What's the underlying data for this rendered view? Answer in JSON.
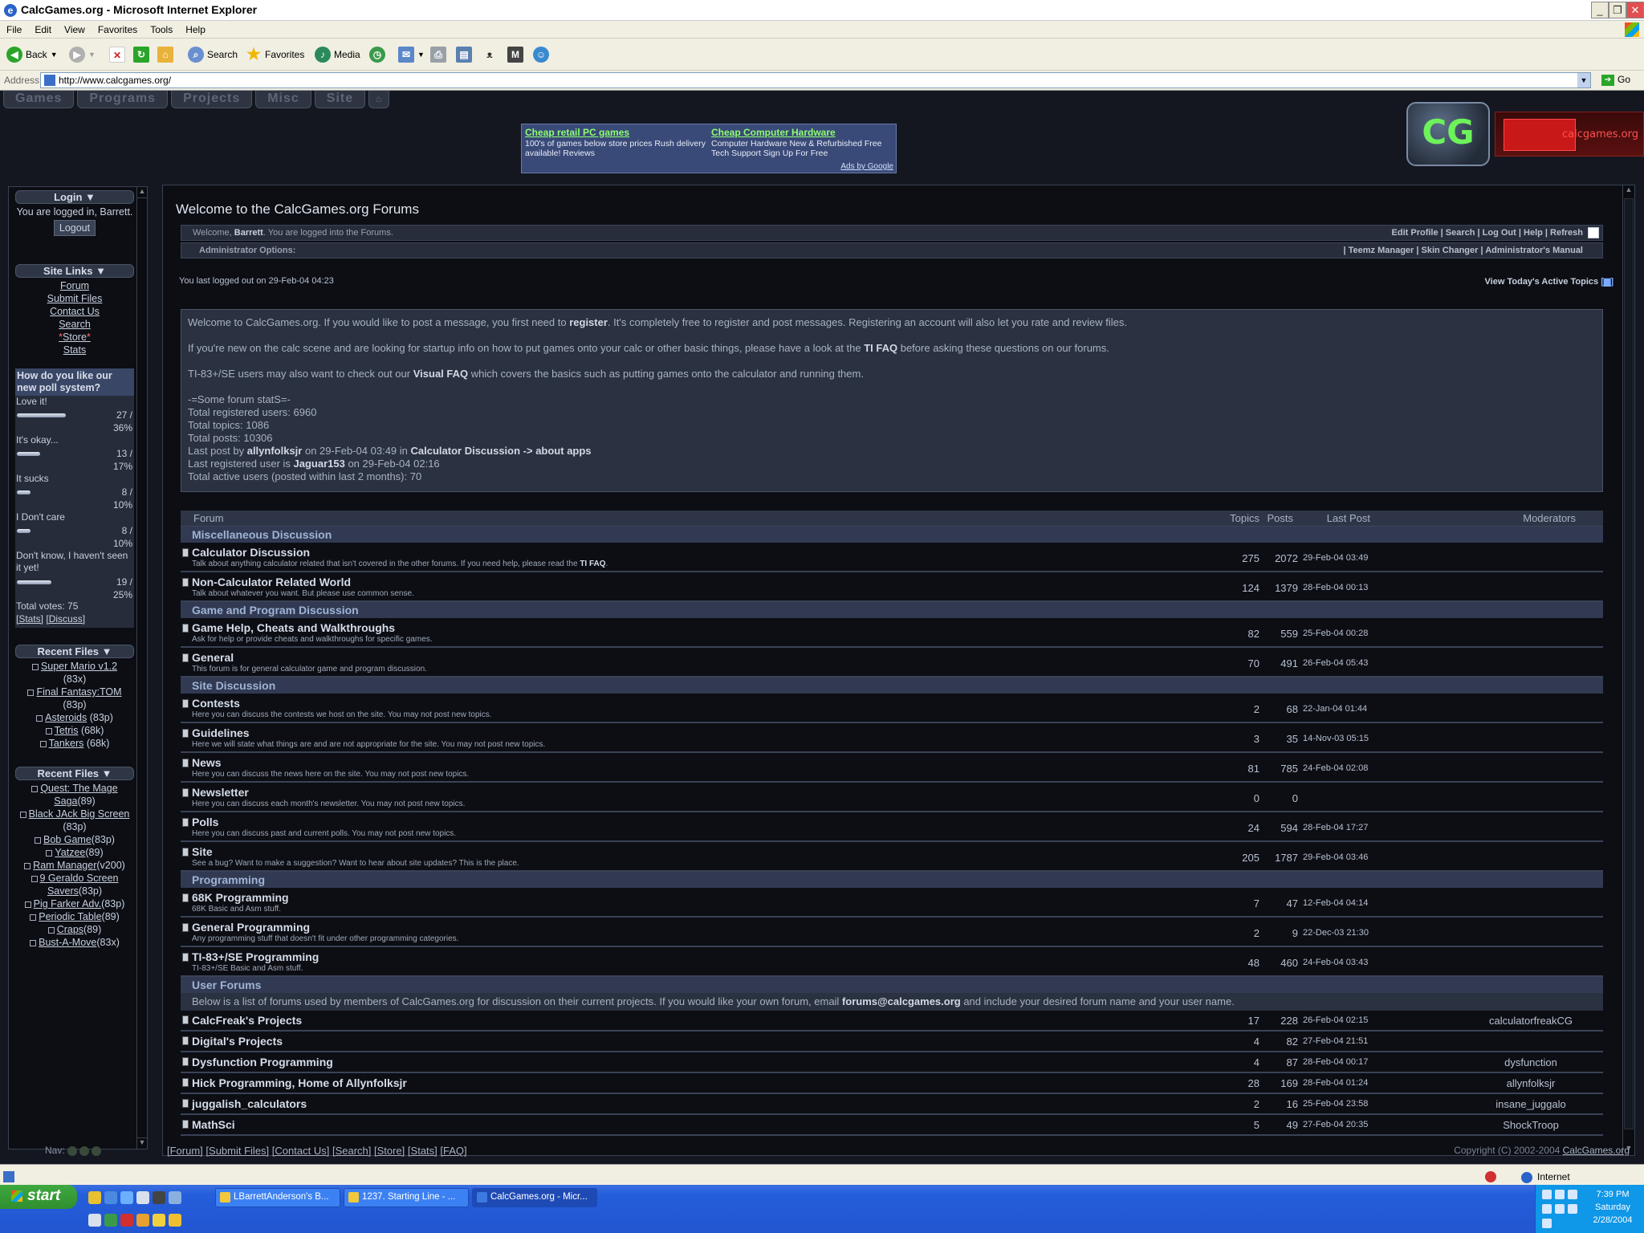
{
  "window": {
    "title": "CalcGames.org - Microsoft Internet Explorer"
  },
  "menu": [
    "File",
    "Edit",
    "View",
    "Favorites",
    "Tools",
    "Help"
  ],
  "toolbar": {
    "back": "Back",
    "search": "Search",
    "favorites": "Favorites",
    "media": "Media"
  },
  "address": {
    "label": "Address",
    "url": "http://www.calcgames.org/",
    "go": "Go"
  },
  "site_tabs": [
    "Games",
    "Programs",
    "Projects",
    "Misc",
    "Site"
  ],
  "ad": {
    "items": [
      {
        "title": "Cheap retail PC games",
        "text": "100's of games below store prices Rush delivery available! Reviews"
      },
      {
        "title": "Cheap Computer Hardware",
        "text": "Computer Hardware New & Refurbished Free Tech Support Sign Up For Free"
      }
    ],
    "by": "Ads by Google"
  },
  "logo": {
    "mark": "CG",
    "text": "calcgames.org"
  },
  "sidebar": {
    "login_head": "Login ▼",
    "login_text": "You are logged in, Barrett.",
    "logout": "Logout",
    "links_head": "Site Links ▼",
    "links": [
      "Forum",
      "Submit Files",
      "Contact Us",
      "Search",
      "Store",
      "Stats"
    ],
    "store_star": "*",
    "poll": {
      "question": "How do you like our new poll system?",
      "options": [
        {
          "label": "Love it!",
          "count": "27 /",
          "pct": "36%",
          "frac": 0.36
        },
        {
          "label": "It's okay...",
          "count": "13 /",
          "pct": "17%",
          "frac": 0.17
        },
        {
          "label": "It sucks",
          "count": "8 /",
          "pct": "10%",
          "frac": 0.1
        },
        {
          "label": "I Don't care",
          "count": "8 /",
          "pct": "10%",
          "frac": 0.1
        },
        {
          "label": "Don't know, I haven't seen it yet!",
          "count": "19 /",
          "pct": "25%",
          "frac": 0.25
        }
      ],
      "total": "Total votes: 75",
      "stats": "[Stats]",
      "discuss": "[Discuss]"
    },
    "recent1_head": "Recent Files ▼",
    "recent1": [
      {
        "name": "Super Mario v1.2",
        "tag": "(83x)"
      },
      {
        "name": "Final Fantasy:TOM",
        "tag": "(83p)"
      },
      {
        "name": "Asteroids",
        "tag": "(83p)"
      },
      {
        "name": "Tetris",
        "tag": "(68k)"
      },
      {
        "name": "Tankers",
        "tag": "(68k)"
      }
    ],
    "recent2_head": "Recent Files ▼",
    "recent2": [
      {
        "name": "Quest: The Mage Saga",
        "tag": "(89)"
      },
      {
        "name": "Black JAck Big Screen",
        "tag": "(83p)"
      },
      {
        "name": "Bob Game",
        "tag": "(83p)"
      },
      {
        "name": "Yatzee",
        "tag": "(89)"
      },
      {
        "name": "Ram Manager",
        "tag": "(v200)"
      },
      {
        "name": "9 Geraldo Screen Savers",
        "tag": "(83p)"
      },
      {
        "name": "Pig Farker Adv.",
        "tag": "(83p)"
      },
      {
        "name": "Periodic Table",
        "tag": "(89)"
      },
      {
        "name": "Craps",
        "tag": "(89)"
      },
      {
        "name": "Bust-A-Move",
        "tag": "(83x)"
      }
    ]
  },
  "main": {
    "title": "Welcome to the CalcGames.org Forums",
    "welcome_pre": "Welcome, ",
    "user": "Barrett",
    "welcome_post": ". You are logged into the Forums.",
    "user_links": "Edit Profile  |  Search  |  Log Out  |  Help  |  Refresh",
    "admin_label": "Administrator Options:",
    "admin_links": "|  Teemz Manager  |  Skin Changer  |  Administrator's Manual",
    "last_logged": "You last logged out on 29-Feb-04 04:23",
    "active_topics": "View Today's Active Topics",
    "intro": {
      "p1_a": "Welcome to CalcGames.org. If you would like to post a message, you first need to ",
      "p1_b": "register",
      "p1_c": ". It's completely free to register and post messages. Registering an account will also let you rate and review files.",
      "p2_a": "If you're new on the calc scene and are looking for startup info on how to put games onto your calc or other basic things, please have a look at the ",
      "p2_b": "TI FAQ",
      "p2_c": " before asking these questions on our forums.",
      "p3_a": "TI-83+/SE users may also want to check out our ",
      "p3_b": "Visual FAQ",
      "p3_c": " which covers the basics such as putting games onto the calculator and running them.",
      "stats_head": "-=Some forum statS=-",
      "s1": "Total registered users: 6960",
      "s2": "Total topics: 1086",
      "s3": "Total posts: 10306",
      "s4_a": "Last post by ",
      "s4_b": "allynfolksjr",
      "s4_c": " on 29-Feb-04 03:49 in ",
      "s4_d": "Calculator Discussion -> about apps",
      "s5_a": "Last registered user is ",
      "s5_b": "Jaguar153",
      "s5_c": " on 29-Feb-04 02:16",
      "s6": "Total active users (posted within last 2 months): 70"
    },
    "headers": {
      "forum": "Forum",
      "topics": "Topics",
      "posts": "Posts",
      "last": "Last Post",
      "mods": "Moderators"
    },
    "categories": [
      {
        "name": "Miscellaneous Discussion",
        "forums": [
          {
            "name": "Calculator Discussion",
            "desc": "Talk about anything calculator related that isn't covered in the other forums. If you need help, please read the ",
            "desc_b": "TI FAQ",
            "desc_c": ".",
            "topics": "275",
            "posts": "2072",
            "last": "29-Feb-04 03:49",
            "mods": ""
          },
          {
            "name": "Non-Calculator Related World",
            "desc": "Talk about whatever you want. But please use common sense.",
            "topics": "124",
            "posts": "1379",
            "last": "28-Feb-04 00:13",
            "mods": ""
          }
        ]
      },
      {
        "name": "Game and Program Discussion",
        "forums": [
          {
            "name": "Game Help, Cheats and Walkthroughs",
            "desc": "Ask for help or provide cheats and walkthroughs for specific games.",
            "topics": "82",
            "posts": "559",
            "last": "25-Feb-04 00:28",
            "mods": ""
          },
          {
            "name": "General",
            "desc": "This forum is for general calculator game and program discussion.",
            "topics": "70",
            "posts": "491",
            "last": "26-Feb-04 05:43",
            "mods": ""
          }
        ]
      },
      {
        "name": "Site Discussion",
        "forums": [
          {
            "name": "Contests",
            "desc": "Here you can discuss the contests we host on the site. You may not post new topics.",
            "topics": "2",
            "posts": "68",
            "last": "22-Jan-04 01:44",
            "mods": ""
          },
          {
            "name": "Guidelines",
            "desc": "Here we will state what things are and are not appropriate for the site. You may not post new topics.",
            "topics": "3",
            "posts": "35",
            "last": "14-Nov-03 05:15",
            "mods": ""
          },
          {
            "name": "News",
            "desc": "Here you can discuss the news here on the site. You may not post new topics.",
            "topics": "81",
            "posts": "785",
            "last": "24-Feb-04 02:08",
            "mods": ""
          },
          {
            "name": "Newsletter",
            "desc": "Here you can discuss each month's newsletter. You may not post new topics.",
            "topics": "0",
            "posts": "0",
            "last": "",
            "mods": ""
          },
          {
            "name": "Polls",
            "desc": "Here you can discuss past and current polls. You may not post new topics.",
            "topics": "24",
            "posts": "594",
            "last": "28-Feb-04 17:27",
            "mods": ""
          },
          {
            "name": "Site",
            "desc": "See a bug? Want to make a suggestion? Want to hear about site updates? This is the place.",
            "topics": "205",
            "posts": "1787",
            "last": "29-Feb-04 03:46",
            "mods": ""
          }
        ]
      },
      {
        "name": "Programming",
        "forums": [
          {
            "name": "68K Programming",
            "desc": "68K Basic and Asm stuff.",
            "topics": "7",
            "posts": "47",
            "last": "12-Feb-04 04:14",
            "mods": ""
          },
          {
            "name": "General Programming",
            "desc": "Any programming stuff that doesn't fit under other programming categories.",
            "topics": "2",
            "posts": "9",
            "last": "22-Dec-03 21:30",
            "mods": ""
          },
          {
            "name": "TI-83+/SE Programming",
            "desc": "TI-83+/SE Basic and Asm stuff.",
            "topics": "48",
            "posts": "460",
            "last": "24-Feb-04 03:43",
            "mods": ""
          }
        ]
      }
    ],
    "user_forums": {
      "name": "User Forums",
      "note_a": "Below is a list of forums used by members of CalcGames.org for discussion on their current projects. If you would like your own forum, email ",
      "note_b": "forums@calcgames.org",
      "note_c": " and include your desired forum name and your user name.",
      "forums": [
        {
          "name": "CalcFreak's Projects",
          "topics": "17",
          "posts": "228",
          "last": "26-Feb-04 02:15",
          "mods": "calculatorfreakCG"
        },
        {
          "name": "Digital's Projects",
          "topics": "4",
          "posts": "82",
          "last": "27-Feb-04 21:51",
          "mods": ""
        },
        {
          "name": "Dysfunction Programming",
          "topics": "4",
          "posts": "87",
          "last": "28-Feb-04 00:17",
          "mods": "dysfunction"
        },
        {
          "name": "Hick Programming, Home of Allynfolksjr",
          "topics": "28",
          "posts": "169",
          "last": "28-Feb-04 01:24",
          "mods": "allynfolksjr"
        },
        {
          "name": "juggalish_calculators",
          "topics": "2",
          "posts": "16",
          "last": "25-Feb-04 23:58",
          "mods": "insane_juggalo"
        },
        {
          "name": "MathSci",
          "topics": "5",
          "posts": "49",
          "last": "27-Feb-04 20:35",
          "mods": "ShockTroop"
        }
      ]
    }
  },
  "footer": {
    "nav": "Nav:",
    "links": [
      "[Forum]",
      "[Submit Files]",
      "[Contact Us]",
      "[Search]",
      "[Store]",
      "[Stats]",
      "[FAQ]"
    ],
    "copy": "Copyright (C) 2002-2004 ",
    "copy_link": "CalcGames.org"
  },
  "statusbar": {
    "zone": "Internet"
  },
  "taskbar": {
    "start": "start",
    "tasks": [
      "LBarrettAnderson's B...",
      "1237. Starting Line - ...",
      "CalcGames.org - Micr..."
    ],
    "time": "7:39 PM",
    "day": "Saturday",
    "date": "2/28/2004"
  }
}
